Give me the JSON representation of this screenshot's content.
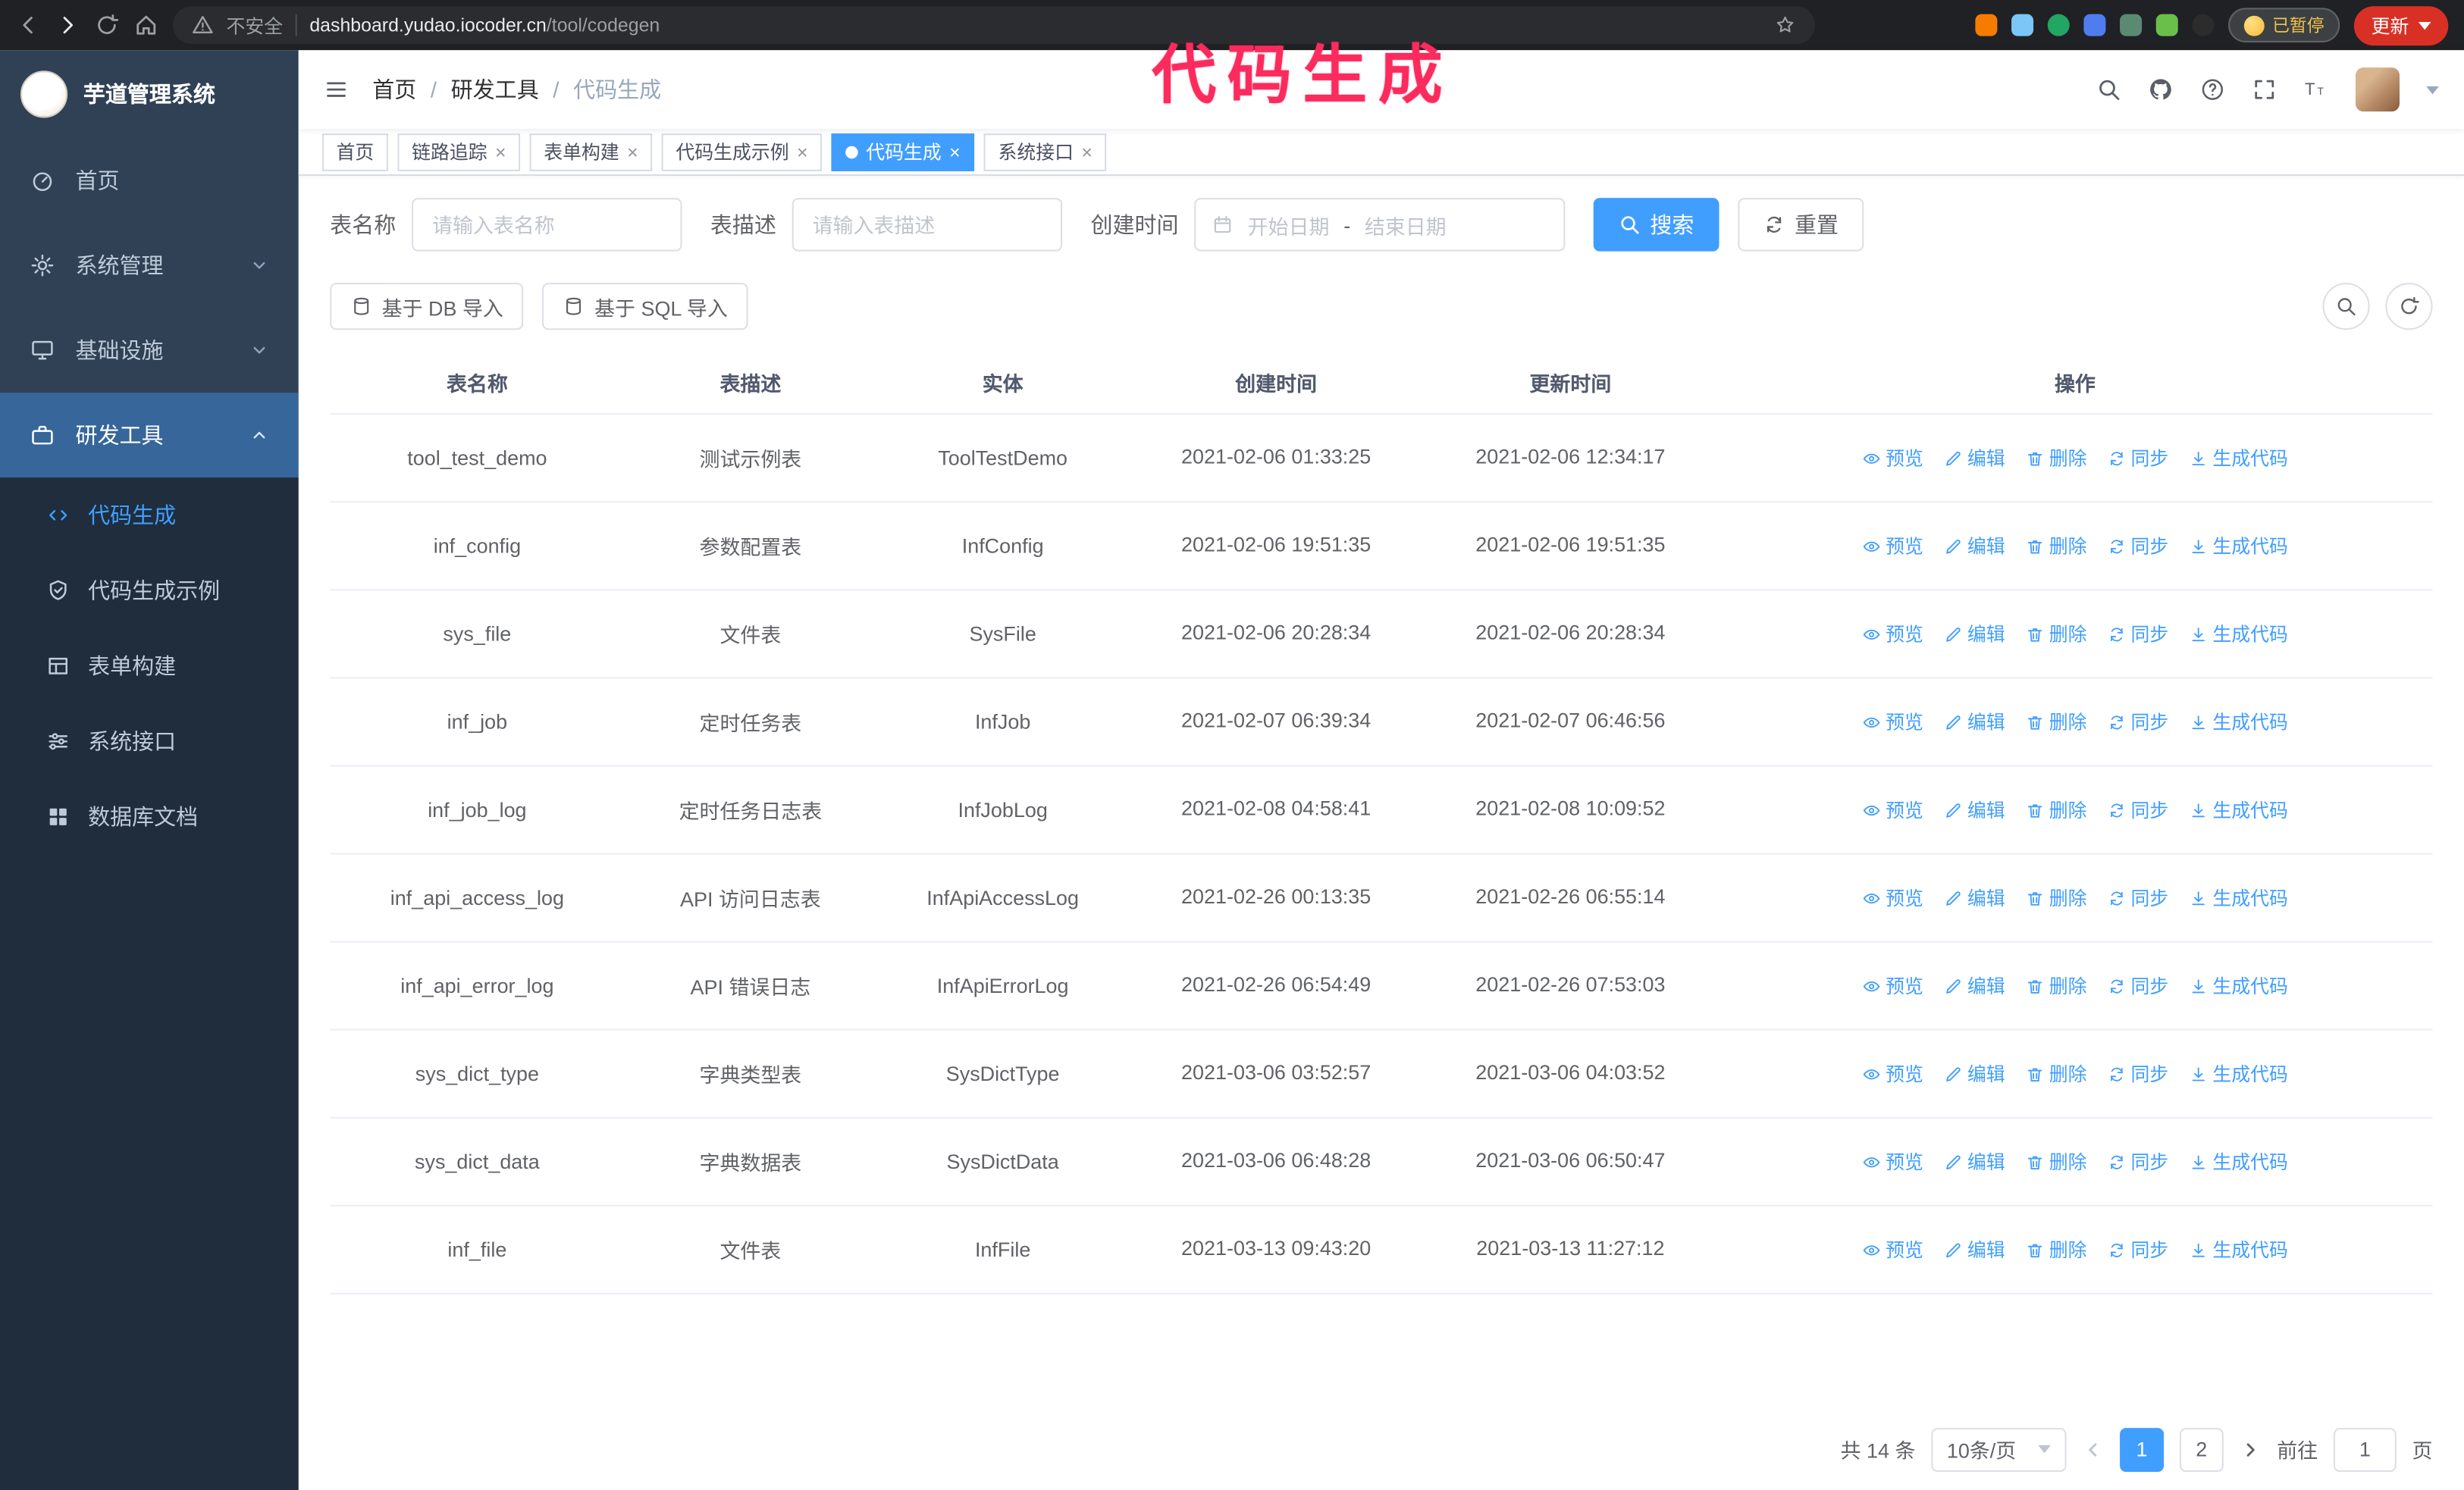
{
  "browser": {
    "security_label": "不安全",
    "url_domain": "dashboard.yudao.iocoder.cn",
    "url_path": "/tool/codegen",
    "paused_badge": "已暂停",
    "update_button": "更新"
  },
  "annotation": "代码生成",
  "sidebar": {
    "logo_title": "芋道管理系统",
    "items": [
      {
        "label": "首页"
      },
      {
        "label": "系统管理"
      },
      {
        "label": "基础设施"
      },
      {
        "label": "研发工具"
      }
    ],
    "submenu": [
      {
        "label": "代码生成"
      },
      {
        "label": "代码生成示例"
      },
      {
        "label": "表单构建"
      },
      {
        "label": "系统接口"
      },
      {
        "label": "数据库文档"
      }
    ]
  },
  "breadcrumb": [
    "首页",
    "研发工具",
    "代码生成"
  ],
  "tabs": [
    "首页",
    "链路追踪",
    "表单构建",
    "代码生成示例",
    "代码生成",
    "系统接口"
  ],
  "filters": {
    "table_name_label": "表名称",
    "table_name_placeholder": "请输入表名称",
    "table_desc_label": "表描述",
    "table_desc_placeholder": "请输入表描述",
    "create_time_label": "创建时间",
    "start_date_placeholder": "开始日期",
    "range_separator": "-",
    "end_date_placeholder": "结束日期",
    "search_button": "搜索",
    "reset_button": "重置"
  },
  "toolbar": {
    "import_db_button": "基于 DB 导入",
    "import_sql_button": "基于 SQL 导入"
  },
  "table": {
    "columns": [
      "表名称",
      "表描述",
      "实体",
      "创建时间",
      "更新时间",
      "操作"
    ],
    "actions": [
      "预览",
      "编辑",
      "删除",
      "同步",
      "生成代码"
    ],
    "rows": [
      {
        "name": "tool_test_demo",
        "desc": "测试示例表",
        "entity": "ToolTestDemo",
        "created": "2021-02-06 01:33:25",
        "updated": "2021-02-06 12:34:17"
      },
      {
        "name": "inf_config",
        "desc": "参数配置表",
        "entity": "InfConfig",
        "created": "2021-02-06 19:51:35",
        "updated": "2021-02-06 19:51:35"
      },
      {
        "name": "sys_file",
        "desc": "文件表",
        "entity": "SysFile",
        "created": "2021-02-06 20:28:34",
        "updated": "2021-02-06 20:28:34"
      },
      {
        "name": "inf_job",
        "desc": "定时任务表",
        "entity": "InfJob",
        "created": "2021-02-07 06:39:34",
        "updated": "2021-02-07 06:46:56"
      },
      {
        "name": "inf_job_log",
        "desc": "定时任务日志表",
        "entity": "InfJobLog",
        "created": "2021-02-08 04:58:41",
        "updated": "2021-02-08 10:09:52"
      },
      {
        "name": "inf_api_access_log",
        "desc": "API 访问日志表",
        "entity": "InfApiAccessLog",
        "created": "2021-02-26 00:13:35",
        "updated": "2021-02-26 06:55:14"
      },
      {
        "name": "inf_api_error_log",
        "desc": "API 错误日志",
        "entity": "InfApiErrorLog",
        "created": "2021-02-26 06:54:49",
        "updated": "2021-02-26 07:53:03"
      },
      {
        "name": "sys_dict_type",
        "desc": "字典类型表",
        "entity": "SysDictType",
        "created": "2021-03-06 03:52:57",
        "updated": "2021-03-06 04:03:52"
      },
      {
        "name": "sys_dict_data",
        "desc": "字典数据表",
        "entity": "SysDictData",
        "created": "2021-03-06 06:48:28",
        "updated": "2021-03-06 06:50:47"
      },
      {
        "name": "inf_file",
        "desc": "文件表",
        "entity": "InfFile",
        "created": "2021-03-13 09:43:20",
        "updated": "2021-03-13 11:27:12"
      }
    ]
  },
  "pagination": {
    "total": "共 14 条",
    "page_size": "10条/页",
    "pages": [
      "1",
      "2"
    ],
    "goto_label": "前往",
    "goto_value": "1",
    "goto_unit": "页"
  },
  "colors": {
    "accent": "#409eff",
    "annotation_color": "#fb2b5e",
    "sidebar_bg": "#304156",
    "submenu_bg": "#1f2d3d"
  }
}
